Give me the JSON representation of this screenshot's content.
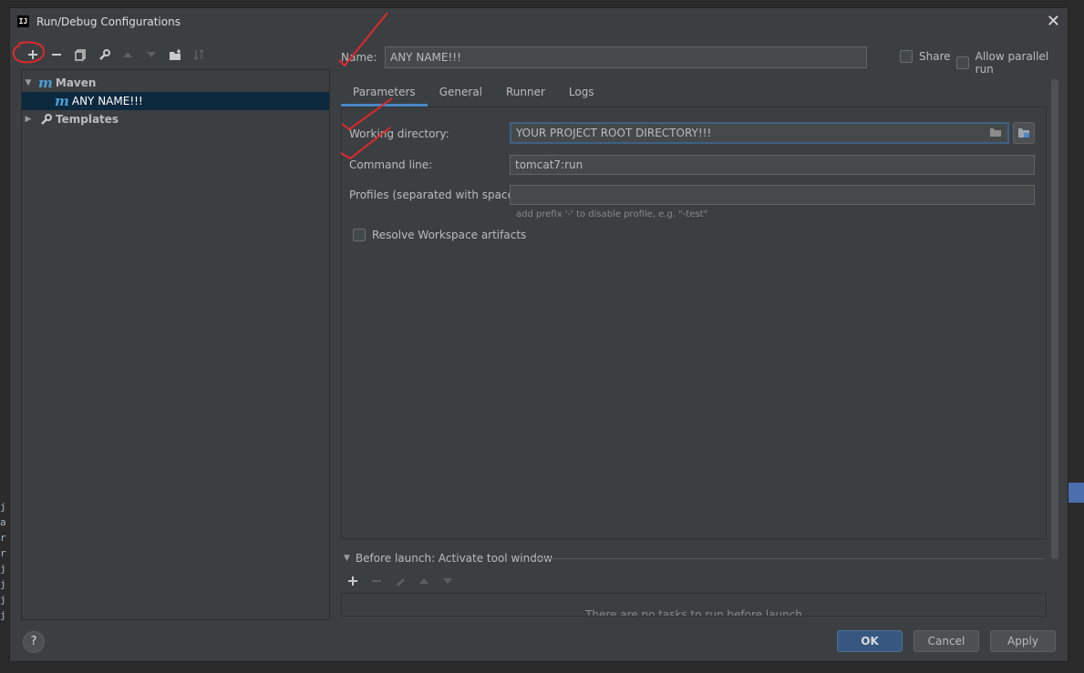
{
  "window": {
    "title": "Run/Debug Configurations",
    "app_icon": "IJ"
  },
  "toolbar": {
    "icons": [
      "add-icon",
      "remove-icon",
      "copy-icon",
      "wrench-icon",
      "move-up-icon",
      "move-down-icon",
      "new-folder-icon",
      "sort-icon"
    ]
  },
  "tree": {
    "maven": {
      "label": "Maven",
      "icon": "maven-icon"
    },
    "config": {
      "label": "ANY NAME!!!",
      "icon": "maven-icon"
    },
    "templates": {
      "label": "Templates",
      "icon": "wrench-icon"
    }
  },
  "form": {
    "name_label": "Name:",
    "name_value": "ANY NAME!!!",
    "share_label": "Share",
    "parallel_label": "Allow parallel run"
  },
  "tabs": [
    {
      "label": "Parameters",
      "active": true
    },
    {
      "label": "General",
      "active": false
    },
    {
      "label": "Runner",
      "active": false
    },
    {
      "label": "Logs",
      "active": false
    }
  ],
  "params": {
    "working_dir_label": "Working directory:",
    "working_dir_value": "YOUR PROJECT ROOT DIRECTORY!!!",
    "command_line_label": "Command line:",
    "command_line_value": "tomcat7:run",
    "profiles_label": "Profiles (separated with space):",
    "profiles_value": "",
    "profiles_hint": "add prefix '-' to disable profile, e.g. \"-test\"",
    "resolve_label": "Resolve Workspace artifacts"
  },
  "before_launch": {
    "label": "Before launch: Activate tool window",
    "empty_text": "There are no tasks to run before launch"
  },
  "buttons": {
    "help": "?",
    "ok": "OK",
    "cancel": "Cancel",
    "apply": "Apply"
  },
  "colors": {
    "accent": "#365880",
    "selection": "#0d293e",
    "annotation": "#e0282c"
  }
}
